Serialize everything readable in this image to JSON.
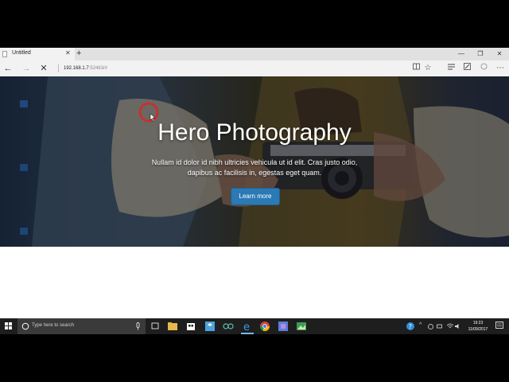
{
  "browser": {
    "tab": {
      "title": "Untitled",
      "close_glyph": "✕",
      "new_tab_glyph": "+"
    },
    "window_controls": {
      "minimize": "—",
      "restore": "❐",
      "close": "✕"
    },
    "address": {
      "host": "192.168.1.7",
      "rest": ":52463/#"
    },
    "nav": {
      "back": "←",
      "forward": "→",
      "stop": "✕"
    },
    "toolbar": {
      "favorite": "☆",
      "more": "⋯"
    }
  },
  "hero": {
    "title": "Hero Photography",
    "text": "Nullam id dolor id nibh ultricies vehicula ut id elit. Cras justo odio, dapibus ac facilisis in, egestas eget quam.",
    "button_label": "Learn more",
    "button_color": "#2b79b5"
  },
  "taskbar": {
    "search_placeholder": "Type here to search",
    "time": "19:23",
    "date": "11/09/2017",
    "accent": "#76b9ed"
  }
}
